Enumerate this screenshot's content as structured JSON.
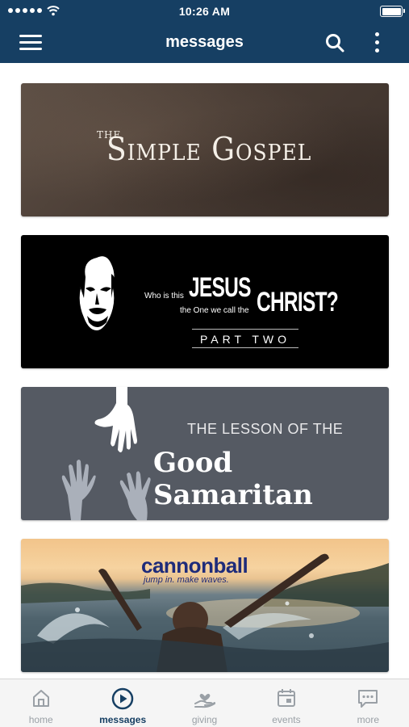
{
  "status_bar": {
    "time": "10:26 AM",
    "icons": [
      "signal-dots-icon",
      "wifi-icon",
      "battery-icon"
    ]
  },
  "header": {
    "title": "messages",
    "icons": [
      "menu-icon",
      "search-icon",
      "more-vertical-icon"
    ]
  },
  "colors": {
    "header_bg": "#163f63",
    "active_tab": "#163f63",
    "inactive_tab": "#9aa0a6"
  },
  "series_cards": [
    {
      "title_prefix": "THE",
      "title": "Simple Gospel"
    },
    {
      "line1_prefix": "Who is this",
      "line1_main": "JESUS",
      "line2_prefix": "the One we call the",
      "line2_main": "CHRIST?",
      "subtitle": "PART TWO"
    },
    {
      "kicker": "THE LESSON OF THE",
      "title": "Good Samaritan"
    },
    {
      "title": "cannonball",
      "tagline": "jump in. make waves."
    }
  ],
  "tabs": [
    {
      "label": "home",
      "icon": "home-icon",
      "active": false
    },
    {
      "label": "messages",
      "icon": "play-circle-icon",
      "active": true
    },
    {
      "label": "giving",
      "icon": "hand-heart-icon",
      "active": false
    },
    {
      "label": "events",
      "icon": "calendar-icon",
      "active": false
    },
    {
      "label": "more",
      "icon": "chat-more-icon",
      "active": false
    }
  ]
}
